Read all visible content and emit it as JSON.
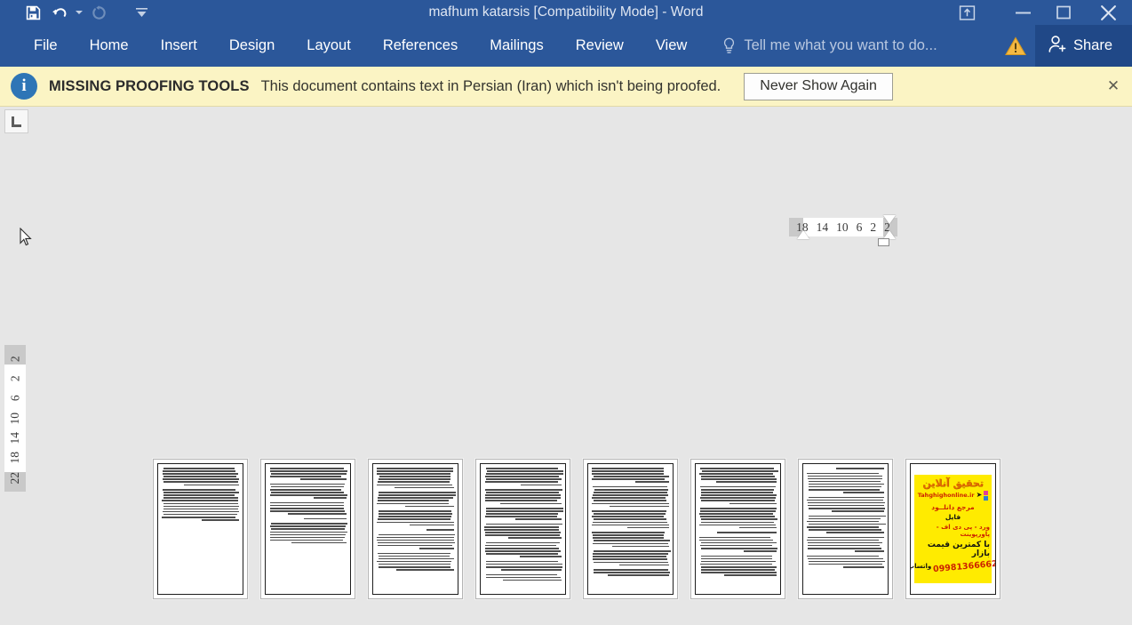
{
  "window": {
    "title": "mafhum katarsis [Compatibility Mode] - Word",
    "quick_access": [
      {
        "name": "save",
        "label": "Save",
        "icon": "floppy-disk-icon",
        "state": "enabled"
      },
      {
        "name": "undo",
        "label": "Undo",
        "icon": "undo-arrow-icon",
        "state": "enabled"
      },
      {
        "name": "redo",
        "label": "Redo",
        "icon": "redo-circle-icon",
        "state": "disabled"
      },
      {
        "name": "customize",
        "label": "Customize Quick Access Toolbar",
        "icon": "chevron-down-bar-icon",
        "state": "enabled"
      }
    ],
    "controls": [
      {
        "name": "ribbon-display-options",
        "label": "Ribbon Display Options",
        "icon": "ribbon-options-icon"
      },
      {
        "name": "minimize",
        "label": "Minimize",
        "icon": "minimize-icon"
      },
      {
        "name": "restore",
        "label": "Restore Down",
        "icon": "maximize-icon"
      },
      {
        "name": "close",
        "label": "Close",
        "icon": "close-icon"
      }
    ],
    "colors": {
      "titlebar": "#2b579a",
      "ribbon": "#2b579a",
      "share_button": "#204887",
      "notification_bg": "#fbf4c4",
      "workspace_bg": "#e6e6e6",
      "page_bg": "#ffffff",
      "ad_page_bg": "#ffeb00"
    }
  },
  "ribbon": {
    "tabs": [
      {
        "label": "File"
      },
      {
        "label": "Home"
      },
      {
        "label": "Insert"
      },
      {
        "label": "Design"
      },
      {
        "label": "Layout"
      },
      {
        "label": "References"
      },
      {
        "label": "Mailings"
      },
      {
        "label": "Review"
      },
      {
        "label": "View"
      }
    ],
    "tell_me": "Tell me what you want to do...",
    "share_label": "Share",
    "warning_icon": "warning-triangle-icon",
    "bulb_icon": "lightbulb-icon"
  },
  "notification": {
    "icon": "info-circle-icon",
    "info_glyph": "i",
    "title": "MISSING PROOFING TOOLS",
    "message": "This document contains text in Persian (Iran) which isn't being proofed.",
    "button_label": "Never Show Again",
    "close_glyph": "✕"
  },
  "ruler": {
    "tab_selector": {
      "name": "left-tab-stop",
      "glyph": "L"
    },
    "horizontal_numbers": [
      "18",
      "14",
      "10",
      "6",
      "2",
      "2"
    ],
    "vertical_numbers": [
      "2",
      "2",
      "6",
      "10",
      "14",
      "18",
      "22"
    ],
    "indent_markers": [
      "first-line-indent",
      "hanging-indent",
      "left-indent",
      "right-indent"
    ]
  },
  "document": {
    "view": "Multiple Pages",
    "page_count": 8,
    "pages": [
      {
        "index": 1,
        "type": "text",
        "paragraph_lines": [
          7,
          12
        ],
        "trailing_blank": true
      },
      {
        "index": 2,
        "type": "text",
        "paragraph_lines": [
          5,
          6,
          5,
          1,
          8
        ]
      },
      {
        "index": 3,
        "type": "text",
        "paragraph_lines": [
          8,
          6,
          6,
          1,
          6,
          7
        ]
      },
      {
        "index": 4,
        "type": "text",
        "paragraph_lines": [
          7,
          6,
          5,
          6,
          6,
          4,
          3
        ]
      },
      {
        "index": 5,
        "type": "text",
        "paragraph_lines": [
          6,
          8,
          7,
          6,
          6,
          3
        ]
      },
      {
        "index": 6,
        "type": "text",
        "paragraph_lines": [
          6,
          7,
          8,
          1,
          6,
          8
        ]
      },
      {
        "index": 7,
        "type": "text",
        "paragraph_lines": [
          1,
          8,
          6,
          7,
          6,
          5
        ]
      },
      {
        "index": 8,
        "type": "advertisement",
        "background": "#ffeb00",
        "logo": "تحقیق آنلاین",
        "url": "Tahghighonline.ir",
        "line1": "مرجع دانلــود",
        "line2": "فایل",
        "line3": "ورد - پی دی اف - پاورپوینت",
        "line4": "با کمترین قیمت بازار",
        "phone": "09981366662",
        "whatsapp": "واتساپ"
      }
    ]
  }
}
